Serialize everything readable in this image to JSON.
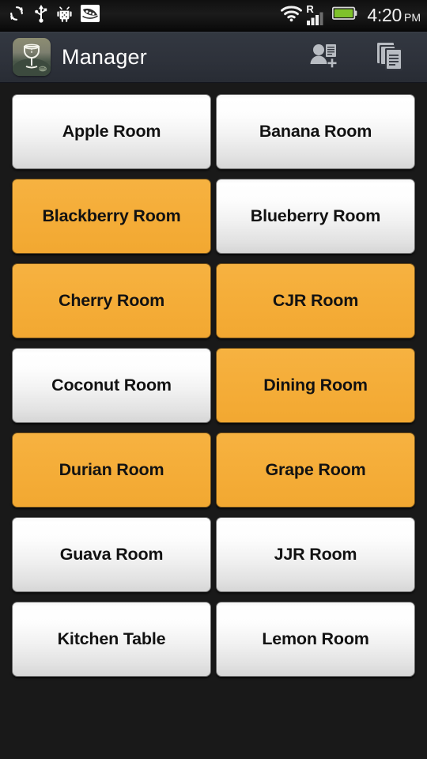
{
  "statusbar": {
    "left_icons": [
      {
        "name": "sync-icon",
        "glyph": "sync"
      },
      {
        "name": "usb-icon",
        "glyph": "usb"
      },
      {
        "name": "android-debug-icon",
        "glyph": "android"
      },
      {
        "name": "pea-pod-icon",
        "glyph": "peapod"
      }
    ],
    "wifi_icon": "wifi-icon",
    "roaming_label": "R",
    "signal_icon": "cellular-signal-icon",
    "battery_icon": "battery-icon",
    "battery_color": "#7fc22b",
    "time": "4:20",
    "ampm": "PM"
  },
  "actionbar": {
    "app_icon_name": "wine-glass-app-icon",
    "title": "Manager",
    "actions": [
      {
        "name": "add-guest-icon",
        "label": "Add guest"
      },
      {
        "name": "copy-documents-icon",
        "label": "Copy"
      }
    ]
  },
  "theme": {
    "background": "#191919",
    "actionbar_bg": "#2e323b",
    "occupied_color": "#f5ae3a",
    "free_color": "#f2f2f2",
    "label_color": "#121212"
  },
  "rooms": [
    {
      "label": "Apple Room",
      "state": "free"
    },
    {
      "label": "Banana Room",
      "state": "free"
    },
    {
      "label": "Blackberry Room",
      "state": "occupied"
    },
    {
      "label": "Blueberry Room",
      "state": "free"
    },
    {
      "label": "Cherry Room",
      "state": "occupied"
    },
    {
      "label": "CJR Room",
      "state": "occupied"
    },
    {
      "label": "Coconut Room",
      "state": "free"
    },
    {
      "label": "Dining Room",
      "state": "occupied"
    },
    {
      "label": "Durian Room",
      "state": "occupied"
    },
    {
      "label": "Grape Room",
      "state": "occupied"
    },
    {
      "label": "Guava Room",
      "state": "free"
    },
    {
      "label": "JJR Room",
      "state": "free"
    },
    {
      "label": "Kitchen Table",
      "state": "free"
    },
    {
      "label": "Lemon Room",
      "state": "free"
    }
  ]
}
